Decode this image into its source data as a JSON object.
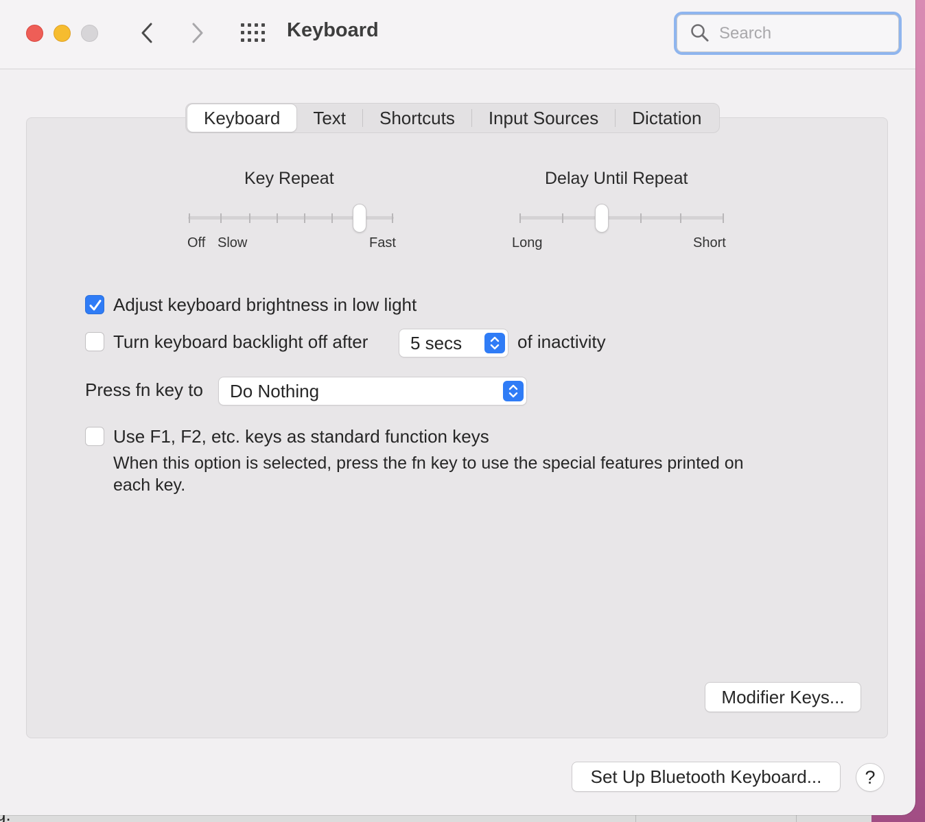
{
  "window": {
    "title": "Keyboard",
    "search_placeholder": "Search"
  },
  "tabs": [
    {
      "label": "Keyboard",
      "active": true
    },
    {
      "label": "Text",
      "active": false
    },
    {
      "label": "Shortcuts",
      "active": false
    },
    {
      "label": "Input Sources",
      "active": false
    },
    {
      "label": "Dictation",
      "active": false
    }
  ],
  "key_repeat": {
    "title": "Key Repeat",
    "labels": {
      "off": "Off",
      "slow": "Slow",
      "fast": "Fast"
    },
    "ticks": 8,
    "value_index": 6
  },
  "delay_until_repeat": {
    "title": "Delay Until Repeat",
    "labels": {
      "long": "Long",
      "short": "Short"
    },
    "ticks": 6,
    "value_index": 2
  },
  "options": {
    "adjust_brightness": {
      "label": "Adjust keyboard brightness in low light",
      "checked": true
    },
    "backlight_off": {
      "label": "Turn keyboard backlight off after",
      "checked": false,
      "popup_value": "5 secs",
      "suffix": "of inactivity"
    },
    "fn_key": {
      "label": "Press fn key to",
      "popup_value": "Do Nothing"
    },
    "function_keys": {
      "label": "Use F1, F2, etc. keys as standard function keys",
      "checked": false,
      "description_line1": "When this option is selected, press the fn key to use the special features printed on",
      "description_line2": "each key."
    }
  },
  "buttons": {
    "modifier_keys": "Modifier Keys...",
    "bluetooth": "Set Up Bluetooth Keyboard...",
    "help": "?"
  },
  "background": {
    "edge_text": "g."
  },
  "colors": {
    "accent": "#2f7cf6",
    "close": "#ee5e57",
    "minimize": "#f6bc2f",
    "zoom_disabled": "#d7d5d8",
    "search_focus_ring": "#8fb5ee"
  }
}
